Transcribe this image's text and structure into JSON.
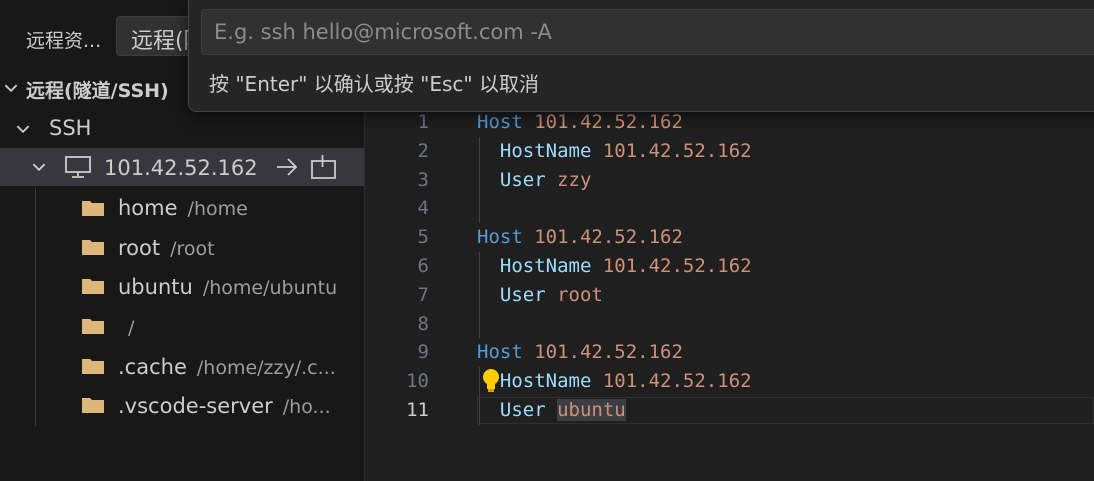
{
  "sidebar": {
    "title": "远程资...",
    "select_value": "远程(隧道/SSH)",
    "section_label": "远程(隧道/SSH)",
    "group_label": "SSH",
    "host": {
      "label": "101.42.52.162",
      "connect_icon": "arrow-right-icon",
      "new_window_icon": "add-window-icon"
    },
    "folders": [
      {
        "name": "home",
        "path": "/home"
      },
      {
        "name": "root",
        "path": "/root"
      },
      {
        "name": "ubuntu",
        "path": "/home/ubuntu"
      },
      {
        "name": "",
        "path": "/"
      },
      {
        "name": ".cache",
        "path": "/home/zzy/.c..."
      },
      {
        "name": ".vscode-server",
        "path": "/ho..."
      }
    ]
  },
  "quick_input": {
    "placeholder": "E.g. ssh hello@microsoft.com -A",
    "value": "",
    "hint": "按 \"Enter\" 以确认或按 \"Esc\" 以取消"
  },
  "editor": {
    "active_line": 11,
    "lines": [
      {
        "n": "1",
        "k": "Host",
        "v": "101.42.52.162"
      },
      {
        "n": "2",
        "k": "HostName",
        "v": "101.42.52.162"
      },
      {
        "n": "3",
        "k": "User",
        "v": "zzy"
      },
      {
        "n": "4",
        "k": "",
        "v": ""
      },
      {
        "n": "5",
        "k": "Host",
        "v": "101.42.52.162"
      },
      {
        "n": "6",
        "k": "HostName",
        "v": "101.42.52.162"
      },
      {
        "n": "7",
        "k": "User",
        "v": "root"
      },
      {
        "n": "8",
        "k": "",
        "v": ""
      },
      {
        "n": "9",
        "k": "Host",
        "v": "101.42.52.162"
      },
      {
        "n": "10",
        "k": "HostName",
        "v": "101.42.52.162"
      },
      {
        "n": "11",
        "k": "User",
        "v": "ubuntu"
      }
    ]
  },
  "colors": {
    "folder": "#dcb67a",
    "keyword": "#569cd6",
    "key": "#9cdcfe",
    "value": "#ce9178"
  }
}
